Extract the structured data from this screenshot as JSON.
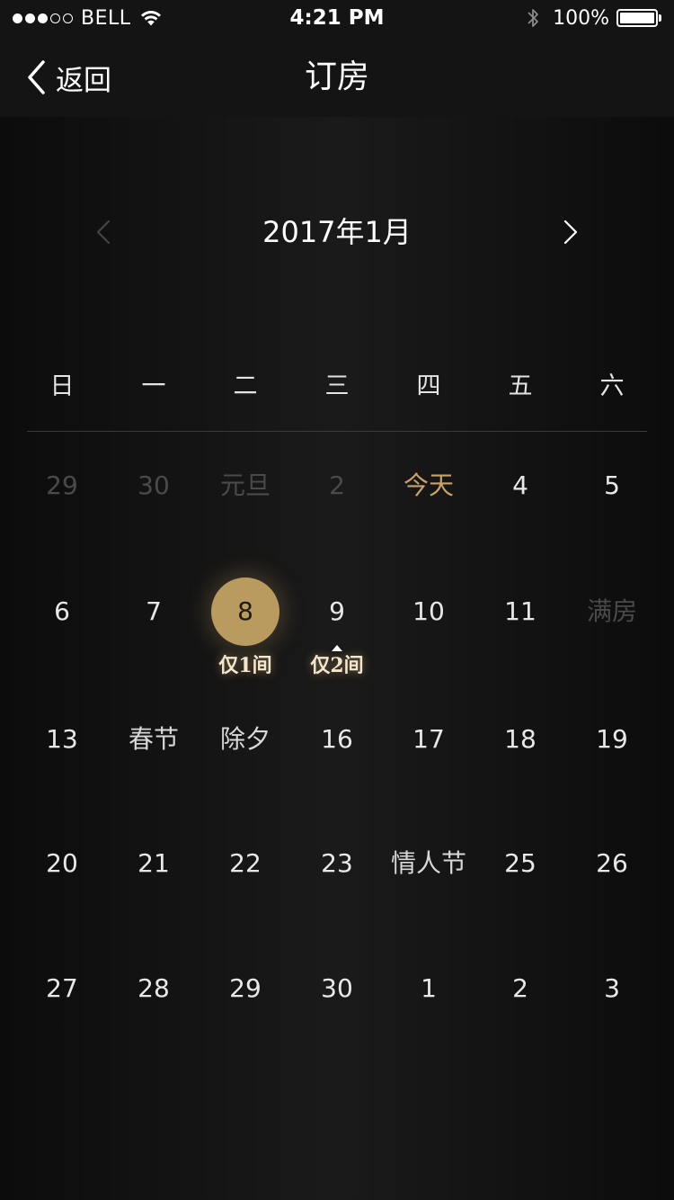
{
  "status_bar": {
    "carrier": "BELL",
    "signal_bars_filled": 3,
    "signal_bars_total": 5,
    "time": "4:21 PM",
    "battery_percent_label": "100%",
    "battery_level": 1.0,
    "icons": [
      "wifi-icon",
      "bluetooth-icon",
      "battery-icon"
    ]
  },
  "nav": {
    "back_label": "返回",
    "title": "订房"
  },
  "calendar": {
    "month_label": "2017年1月",
    "prev_enabled": false,
    "next_enabled": true,
    "weekdays": [
      "日",
      "一",
      "二",
      "三",
      "四",
      "五",
      "六"
    ],
    "weeks": [
      [
        {
          "text": "29",
          "state": "disabled"
        },
        {
          "text": "30",
          "state": "disabled"
        },
        {
          "text": "元旦",
          "state": "disabled"
        },
        {
          "text": "2",
          "state": "disabled"
        },
        {
          "text": "今天",
          "state": "today"
        },
        {
          "text": "4",
          "state": "normal"
        },
        {
          "text": "5",
          "state": "normal"
        }
      ],
      [
        {
          "text": "6",
          "state": "normal"
        },
        {
          "text": "7",
          "state": "normal"
        },
        {
          "text": "8",
          "state": "selected",
          "badge": "仅1间"
        },
        {
          "text": "9",
          "state": "normal",
          "badge": "仅2间",
          "caret": true
        },
        {
          "text": "10",
          "state": "normal"
        },
        {
          "text": "11",
          "state": "normal"
        },
        {
          "text": "满房",
          "state": "full"
        }
      ],
      [
        {
          "text": "13",
          "state": "normal"
        },
        {
          "text": "春节",
          "state": "holiday"
        },
        {
          "text": "除夕",
          "state": "holiday"
        },
        {
          "text": "16",
          "state": "normal"
        },
        {
          "text": "17",
          "state": "normal"
        },
        {
          "text": "18",
          "state": "normal"
        },
        {
          "text": "19",
          "state": "normal"
        }
      ],
      [
        {
          "text": "20",
          "state": "normal"
        },
        {
          "text": "21",
          "state": "normal"
        },
        {
          "text": "22",
          "state": "normal"
        },
        {
          "text": "23",
          "state": "normal"
        },
        {
          "text": "情人节",
          "state": "holiday"
        },
        {
          "text": "25",
          "state": "normal"
        },
        {
          "text": "26",
          "state": "normal"
        }
      ],
      [
        {
          "text": "27",
          "state": "normal"
        },
        {
          "text": "28",
          "state": "normal"
        },
        {
          "text": "29",
          "state": "normal"
        },
        {
          "text": "30",
          "state": "normal"
        },
        {
          "text": "1",
          "state": "normal"
        },
        {
          "text": "2",
          "state": "normal"
        },
        {
          "text": "3",
          "state": "normal"
        }
      ]
    ]
  },
  "colors": {
    "background": "#141414",
    "accent_gold": "#c8a367",
    "selected_fill": "#b99a5f",
    "disabled_text": "#4a4a4a",
    "text": "#e8e8e8"
  }
}
